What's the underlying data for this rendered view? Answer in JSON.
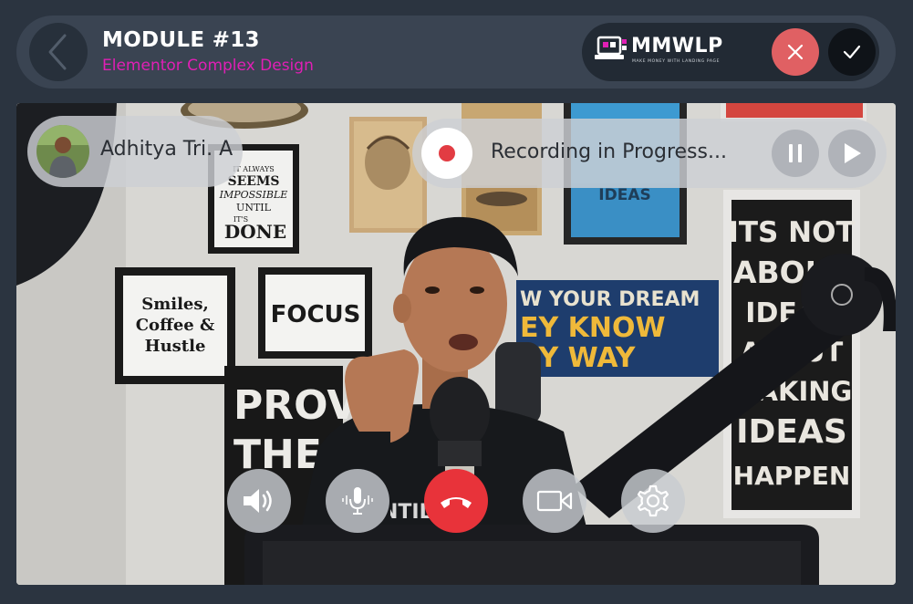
{
  "header": {
    "title": "MODULE #13",
    "subtitle": "Elementor Complex Design"
  },
  "brand": {
    "name": "MMWLP",
    "tagline": "MAKE MONEY WITH LANDING PAGE"
  },
  "call": {
    "participant_name": "Adhitya Tri. A",
    "recording_status": "Recording in Progress..."
  },
  "scene_text": {
    "poster_smiles": [
      "Smiles,",
      "Coffee &",
      "Hustle"
    ],
    "poster_focus": "FOCUS",
    "poster_done": [
      "IT ALWAYS",
      "SEEMS",
      "IMPOSSIBLE",
      "UNTIL",
      "IT'S",
      "DONE"
    ],
    "poster_ideas_left": "IDEAS",
    "poster_dream": [
      "W YOUR DREAM",
      "EY KNOW",
      "EY WAY"
    ],
    "poster_right": [
      "ITS NOT",
      "ABOUT",
      "IDEAS",
      "ABOUT",
      "MAKING",
      "IDEAS",
      "HAPPEN"
    ],
    "poster_prove": [
      "PROV",
      "THE"
    ],
    "shirt": "NTIL  JEV"
  },
  "icons": {
    "back": "chevron-left-icon",
    "close": "close-icon",
    "confirm": "check-icon",
    "record": "record-dot-icon",
    "pause": "pause-icon",
    "play": "play-icon",
    "speaker": "speaker-icon",
    "mic": "microphone-icon",
    "hangup": "phone-hangup-icon",
    "camera": "video-camera-icon",
    "settings": "gear-icon"
  },
  "colors": {
    "accent_magenta": "#e01fb5",
    "danger_red": "#e8333a",
    "close_red": "#e06063",
    "background": "#2b3440",
    "panel": "#3a4452"
  }
}
